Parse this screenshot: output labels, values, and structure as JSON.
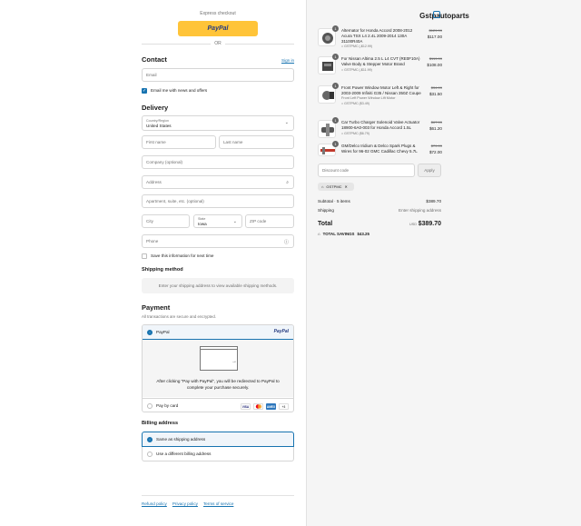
{
  "express": {
    "label": "Express checkout",
    "paypal_label": "PayPal",
    "or_label": "OR"
  },
  "contact": {
    "heading": "Contact",
    "sign_in": "Sign in",
    "email_placeholder": "Email",
    "email_news_label": "Email me with news and offers",
    "email_news_checked": true
  },
  "delivery": {
    "heading": "Delivery",
    "country_label": "Country/Region",
    "country_value": "United States",
    "first_name_placeholder": "First name",
    "last_name_placeholder": "Last name",
    "company_placeholder": "Company (optional)",
    "address_placeholder": "Address",
    "apartment_placeholder": "Apartment, suite, etc. (optional)",
    "city_placeholder": "City",
    "state_label": "State",
    "state_value": "Iowa",
    "zip_placeholder": "ZIP code",
    "phone_placeholder": "Phone",
    "save_info_label": "Save this information for next time"
  },
  "shipping": {
    "heading": "Shipping method",
    "message": "Enter your shipping address to view available shipping methods."
  },
  "payment": {
    "heading": "Payment",
    "subtext": "All transactions are secure and encrypted.",
    "paypal_option": "PayPal",
    "paypal_logo": "PayPal",
    "paypal_message": "After clicking “Pay with PayPal”, you will be redirected to PayPal to complete your purchase securely.",
    "card_option": "Pay by card",
    "card_brands": [
      "VISA",
      "MC",
      "AMEX",
      "+3"
    ]
  },
  "billing": {
    "heading": "Billing address",
    "same_label": "Same as shipping address",
    "different_label": "Use a different billing address"
  },
  "footer": {
    "links": [
      "Refund policy",
      "Privacy policy",
      "Terms of service"
    ]
  },
  "summary": {
    "shop_name": "Gstpautoparts",
    "items": [
      {
        "qty": "1",
        "name": "Alternator for Honda Accord 2008-2012 Acura TSX L4 2.4L 2009-2014 130A 31100R40A",
        "discount": "GSTPMC (-$12.99)",
        "variant": "",
        "old_price": "$129.99",
        "price": "$117.00"
      },
      {
        "qty": "1",
        "name": "For Nissan Altima 2.5 L L4 CVT (RE0F10A) Valve Body & Stepper Motor Brand",
        "discount": "GSTPMC (-$11.99)",
        "variant": "",
        "old_price": "$119.99",
        "price": "$108.00"
      },
      {
        "qty": "1",
        "name": "Front Power Window Motor Left & Right for 2003-2009 Infiniti G35 / Nissan 350Z Coupe",
        "discount": "GSTPMC ($3.49)",
        "variant": "Front Left Power Window Lift Motor",
        "old_price": "$34.99",
        "price": "$31.50"
      },
      {
        "qty": "1",
        "name": "Car Turbo Charger Solenoid Valve Actuator 18900-6A0-003 for Honda Accord 1.5L",
        "discount": "GSTPMC ($6.79)",
        "variant": "",
        "old_price": "$67.99",
        "price": "$61.20"
      },
      {
        "qty": "1",
        "name": "GM/Delco Iridium & Delco Spark Plugs & Wires for 96-02 GMC Cadillac Chevy 5.7L",
        "discount": "",
        "variant": "",
        "old_price": "$79.99",
        "price": "$72.00"
      }
    ],
    "discount_placeholder": "Discount code",
    "apply_label": "Apply",
    "applied_code": "GSTPMC",
    "subtotal_label": "Subtotal · 5 items",
    "subtotal_value": "$389.70",
    "shipping_label": "Shipping",
    "shipping_value": "Enter shipping address",
    "total_label": "Total",
    "currency": "USD",
    "total_value": "$389.70",
    "savings_label": "TOTAL SAVINGS",
    "savings_value": "$43.25"
  },
  "colors": {
    "accent": "#1773b0",
    "paypal_yellow": "#ffc439",
    "summary_bg": "#f5f5f5"
  }
}
